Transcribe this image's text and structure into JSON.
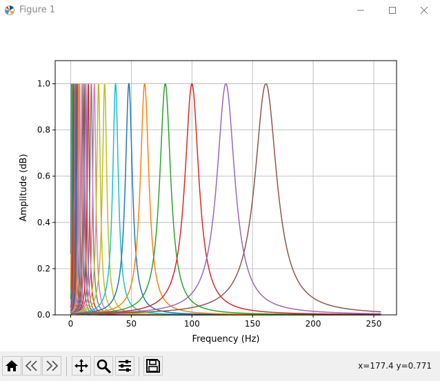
{
  "window": {
    "title": "Figure 1",
    "icons": [
      "matplotlib-icon",
      "minimize-icon",
      "maximize-icon",
      "close-icon"
    ]
  },
  "toolbar": {
    "buttons": [
      "home-icon",
      "back-icon",
      "forward-icon",
      "pan-icon",
      "zoom-icon",
      "configure-subplots-icon",
      "save-icon"
    ],
    "coordinates": "x=177.4 y=0.771"
  },
  "chart_data": {
    "type": "line",
    "title": "",
    "xlabel": "Frequency (Hz)",
    "ylabel": "Amplitude (dB)",
    "xlim": [
      -12.8,
      268.8
    ],
    "ylim": [
      0.0,
      1.1
    ],
    "xticks": [
      0,
      50,
      100,
      150,
      200,
      250
    ],
    "yticks": [
      0.0,
      0.2,
      0.4,
      0.6,
      0.8,
      1.0
    ],
    "xtick_labels": [
      "0",
      "50",
      "100",
      "150",
      "200",
      "250"
    ],
    "ytick_labels": [
      "0.0",
      "0.2",
      "0.4",
      "0.6",
      "0.8",
      "1.0"
    ],
    "grid": true,
    "x_range": [
      0,
      256
    ],
    "series": [
      {
        "center": 0.5,
        "width": 0.3,
        "color": "#1f77b4"
      },
      {
        "center": 1.0,
        "width": 0.35,
        "color": "#ff7f0e"
      },
      {
        "center": 1.5,
        "width": 0.4,
        "color": "#2ca02c"
      },
      {
        "center": 2.5,
        "width": 0.45,
        "color": "#d62728"
      },
      {
        "center": 3.5,
        "width": 0.5,
        "color": "#9467bd"
      },
      {
        "center": 4.5,
        "width": 0.55,
        "color": "#8c564b"
      },
      {
        "center": 5.5,
        "width": 0.6,
        "color": "#1f77b4"
      },
      {
        "center": 6.5,
        "width": 0.65,
        "color": "#ff7f0e"
      },
      {
        "center": 7.5,
        "width": 0.7,
        "color": "#e377c2"
      },
      {
        "center": 9.5,
        "width": 0.8,
        "color": "#7f7f7f"
      },
      {
        "center": 11.0,
        "width": 0.9,
        "color": "#8c564b"
      },
      {
        "center": 12.5,
        "width": 1.0,
        "color": "#9467bd"
      },
      {
        "center": 14.5,
        "width": 1.1,
        "color": "#d62728"
      },
      {
        "center": 17.0,
        "width": 1.3,
        "color": "#7f7f7f"
      },
      {
        "center": 19.5,
        "width": 1.5,
        "color": "#e377c2"
      },
      {
        "center": 23.0,
        "width": 1.8,
        "color": "#bcbd22"
      },
      {
        "center": 28.0,
        "width": 2.2,
        "color": "#bcbd22"
      },
      {
        "center": 37.0,
        "width": 2.8,
        "color": "#17becf"
      },
      {
        "center": 48.0,
        "width": 3.5,
        "color": "#1f77b4"
      },
      {
        "center": 61.0,
        "width": 4.3,
        "color": "#ff7f0e"
      },
      {
        "center": 78.0,
        "width": 5.5,
        "color": "#2ca02c"
      },
      {
        "center": 100.0,
        "width": 7.0,
        "color": "#d62728"
      },
      {
        "center": 128.0,
        "width": 9.0,
        "color": "#9467bd"
      },
      {
        "center": 161.0,
        "width": 11.0,
        "color": "#8c564b"
      }
    ]
  }
}
